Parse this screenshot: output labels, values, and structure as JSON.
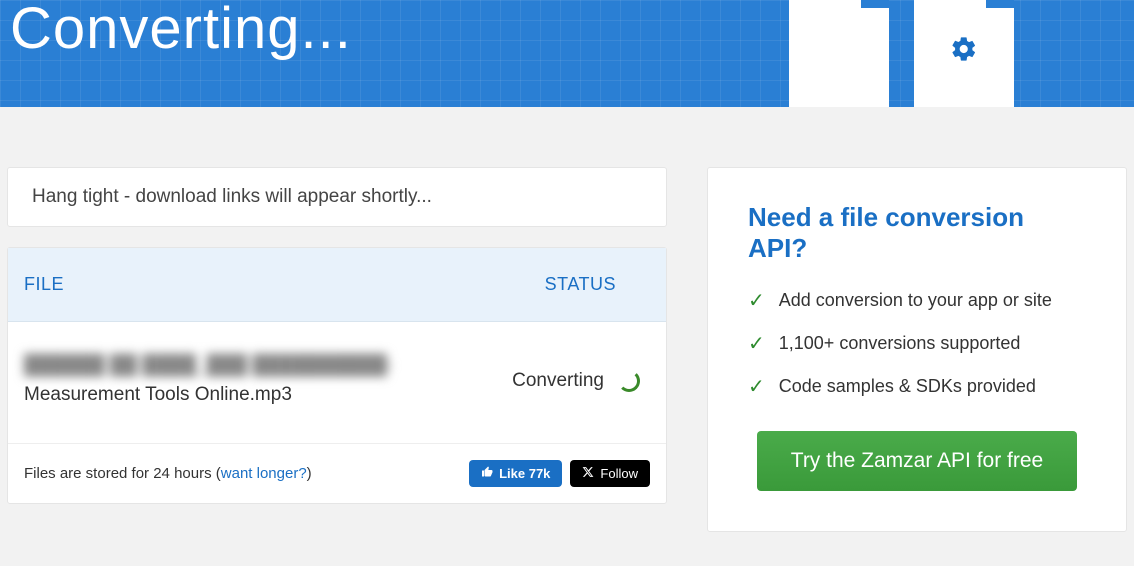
{
  "hero": {
    "title": "Converting..."
  },
  "notice": "Hang tight - download links will appear shortly...",
  "table": {
    "headers": {
      "file": "FILE",
      "status": "STATUS"
    },
    "row": {
      "file_line1_blurred": "██████ ██ ████_███ ██████████-",
      "file_line2": "Measurement Tools Online.mp3",
      "status": "Converting"
    }
  },
  "footer": {
    "storage_prefix": "Files are stored for 24 hours (",
    "storage_link": "want longer?",
    "storage_suffix": ")",
    "like_label": "Like 77k",
    "follow_label": "Follow"
  },
  "api": {
    "title": "Need a file conversion API?",
    "items": [
      "Add conversion to your app or site",
      "1,100+ conversions supported",
      "Code samples & SDKs provided"
    ],
    "cta": "Try the Zamzar API for free"
  }
}
